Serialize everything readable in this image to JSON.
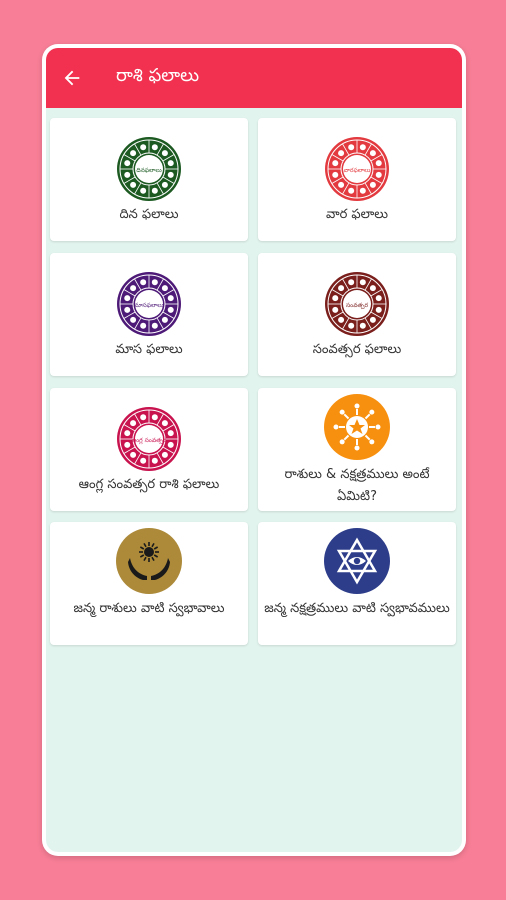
{
  "app": {
    "title": "రాశి ఫలాలు"
  },
  "colors": {
    "appbar": "#f1314f",
    "background": "#f77e96",
    "content_bg": "#e2f4ee"
  },
  "items": [
    {
      "label": "దిన ఫలాలు",
      "icon": "zodiac-wheel-green-icon",
      "color": "#1c5a22",
      "center": "దినఫలాలు"
    },
    {
      "label": "వార ఫలాలు",
      "icon": "zodiac-wheel-red-icon",
      "color": "#e23a3f",
      "center": "వారఫలాలు"
    },
    {
      "label": "మాస ఫలాలు",
      "icon": "zodiac-wheel-purple-icon",
      "color": "#4e1a78",
      "center": "మాసఫలాలు"
    },
    {
      "label": "సంవత్సర ఫలాలు",
      "icon": "zodiac-wheel-maroon-icon",
      "color": "#7a1f1c",
      "center": "సంవత్సర"
    },
    {
      "label": "ఆంగ్ల సంవత్సర రాశి ఫలాలు",
      "icon": "zodiac-wheel-magenta-icon",
      "color": "#c8134f",
      "center": "ఆంగ్ల సంవత్సర"
    },
    {
      "label": "రాశులు & నక్షత్రములు అంటే ఏమిటి?",
      "icon": "sun-star-icon",
      "color": "#f7900f"
    },
    {
      "label": "జన్మ రాశులు వాటి స్వభావాలు",
      "icon": "hands-sun-icon",
      "color": "#ac8a3a"
    },
    {
      "label": "జన్మ నక్షత్రములు వాటి స్వభావములు",
      "icon": "star-of-david-eye-icon",
      "color": "#2d3d8a"
    }
  ]
}
